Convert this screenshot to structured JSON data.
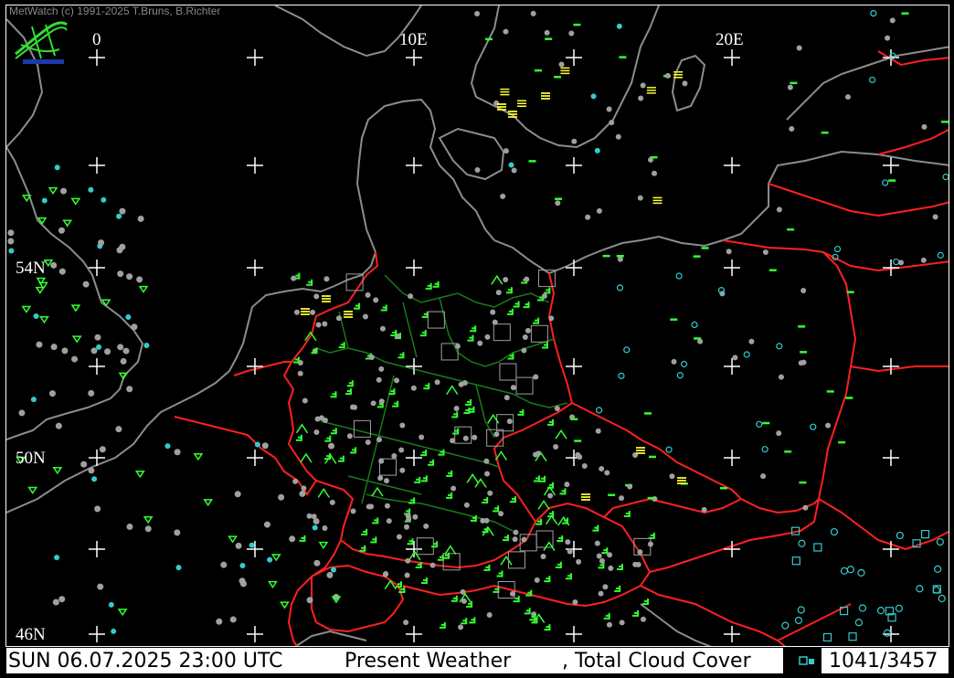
{
  "app": {
    "copyright": "MetWatch  (c) 1991-2025 T.Bruns, B.Richter"
  },
  "map": {
    "longitude_labels": [
      "0",
      "10E",
      "20E"
    ],
    "latitude_labels": [
      "54N",
      "50N",
      "46N"
    ],
    "colors": {
      "background": "#000000",
      "coastline": "#8c8c8c",
      "country_border": "#ff2020",
      "state_border": "#1a7a1a",
      "grid_cross": "#ffffff",
      "station_dot": "#a0a0a0",
      "rain_symbol": "#33ff33",
      "fog_symbol": "#ffff33",
      "clear_symbol": "#33cccc"
    },
    "icons": [
      "metwatch-logo-icon",
      "station-marker-icon",
      "weather-symbol-icon",
      "grid-cross-icon"
    ]
  },
  "status_bar": {
    "datetime": "SUN 06.07.2025 23:00 UTC",
    "product": "Present Weather",
    "overlay": ", Total Cloud Cover",
    "station_count": "1041/3457"
  }
}
